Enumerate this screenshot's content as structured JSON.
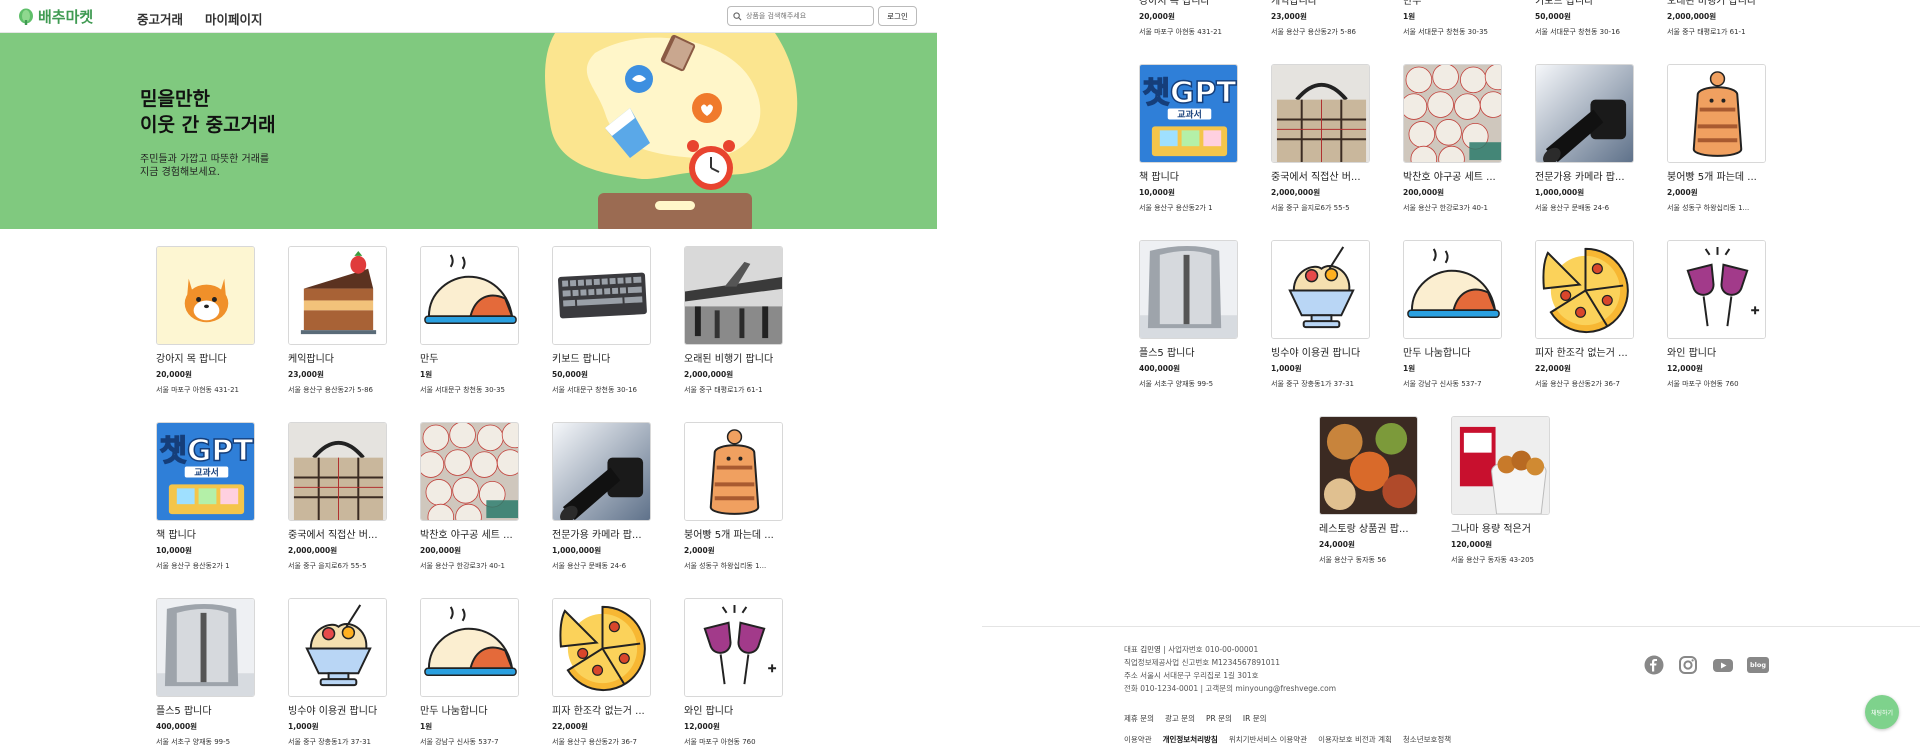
{
  "colors": {
    "brand": "#3f9a52",
    "hero_bg": "#80c97f",
    "chat_button": "#7ed28c"
  },
  "header": {
    "logo_text": "배추마켓",
    "nav": [
      "중고거래",
      "마이페이지"
    ],
    "search_placeholder": "상품을 검색해주세요",
    "login_label": "로그인"
  },
  "hero": {
    "title_line1": "믿을만한",
    "title_line2": "이웃 간 중고거래",
    "sub_line1": "주민들과 가깝고 따뜻한 거래를",
    "sub_line2": "지금 경험해보세요."
  },
  "products": [
    {
      "title": "강아지 목 팝니다",
      "price": "20,000원",
      "addr": "서울 마포구 아현동 431-21",
      "icon": "dog-icon"
    },
    {
      "title": "케익팝니다",
      "price": "23,000원",
      "addr": "서울 용산구 용산동2가 5-86",
      "icon": "cake-icon"
    },
    {
      "title": "만두",
      "price": "1원",
      "addr": "서울 서대문구 창천동 30-35",
      "icon": "dumpling-icon"
    },
    {
      "title": "키보드 팝니다",
      "price": "50,000원",
      "addr": "서울 서대문구 창천동 30-16",
      "icon": "keyboard-icon"
    },
    {
      "title": "오래된 비행기 팝니다",
      "price": "2,000,000원",
      "addr": "서울 중구 태평로1가 61-1",
      "icon": "airplane-photo"
    },
    {
      "title": "책 팝니다",
      "price": "10,000원",
      "addr": "서울 용산구 용산동2가 1",
      "icon": "book-icon",
      "cover_line1": "챗GPT",
      "cover_line2": "교과서"
    },
    {
      "title": "중국에서 직접산 버...",
      "price": "2,000,000원",
      "addr": "서울 중구 을지로6가 55-5",
      "icon": "bag-photo"
    },
    {
      "title": "박찬호 야구공 세트 ...",
      "price": "200,000원",
      "addr": "서울 용산구 한강로3가 40-1",
      "icon": "baseballs-photo"
    },
    {
      "title": "전문가용 카메라 팝...",
      "price": "1,000,000원",
      "addr": "서울 용산구 문배동 24-6",
      "icon": "camera-photo"
    },
    {
      "title": "붕어빵 5개 파는데 ...",
      "price": "2,000원",
      "addr": "서울 성동구 하왕십리동 1...",
      "icon": "fishbread-icon"
    },
    {
      "title": "플스5 팝니다",
      "price": "400,000원",
      "addr": "서울 서초구 양재동 99-5",
      "icon": "ps5-photo"
    },
    {
      "title": "빙수야 이용권 팝니다",
      "price": "1,000원",
      "addr": "서울 중구 장충동1가 37-31",
      "icon": "bingsu-icon"
    },
    {
      "title": "만두 나눔합니다",
      "price": "1원",
      "addr": "서울 강남구 신사동 537-7",
      "icon": "dumpling-icon"
    },
    {
      "title": "피자 한조각 없는거 ...",
      "price": "22,000원",
      "addr": "서울 용산구 용산동2가 36-7",
      "icon": "pizza-icon"
    },
    {
      "title": "와인 팝니다",
      "price": "12,000원",
      "addr": "서울 마포구 아현동 760",
      "icon": "wine-icon"
    },
    {
      "title": "레스토랑 상품권 팝...",
      "price": "24,000원",
      "addr": "서울 용산구 동자동 56",
      "icon": "food-photo"
    },
    {
      "title": "그나마 용량 적은거",
      "price": "120,000원",
      "addr": "서울 용산구 동자동 43-205",
      "icon": "chicken-photo"
    }
  ],
  "footer": {
    "ceo_label": "대표",
    "ceo": "김민영",
    "biz_label": "사업자번호",
    "biz": "010-00-00001",
    "line2": "직업정보제공사업 신고번호 M1234567891011",
    "line3": "주소 서울시 서대문구 우리집로 1길 301호",
    "phone_label": "전화",
    "phone": "010-1234-0001",
    "contact_label": "고객문의",
    "email": "minyoung@freshvege.com",
    "links1": [
      "제휴 문의",
      "광고 문의",
      "PR 문의",
      "IR 문의"
    ],
    "links2": [
      "이용약관",
      "개인정보처리방침",
      "위치기반서비스 이용약관",
      "이용자보호 비전과 계획",
      "청소년보호정책"
    ],
    "social": [
      "facebook-icon",
      "instagram-icon",
      "youtube-icon",
      "blog-icon"
    ],
    "blog_label": "blog"
  },
  "chat_button": "채팅하기"
}
